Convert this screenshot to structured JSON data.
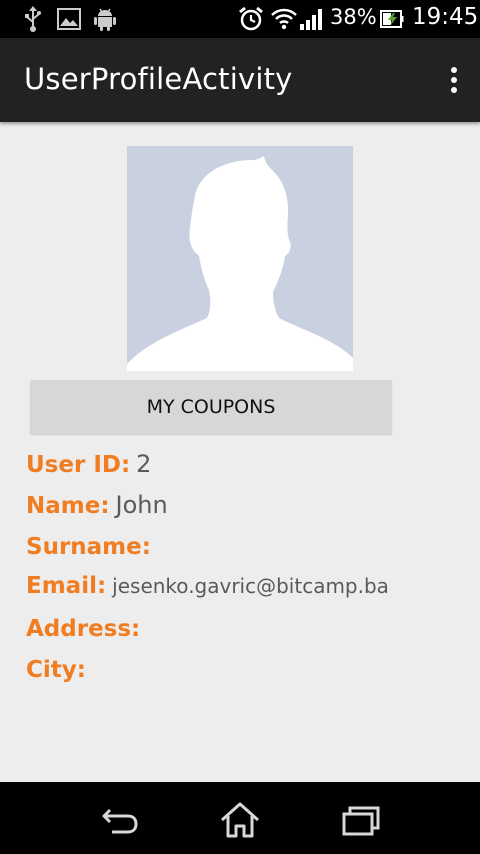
{
  "status_bar": {
    "battery_percent": "38%",
    "time": "19:45",
    "left_icons": [
      "usb-icon",
      "image-icon",
      "android-icon"
    ],
    "right_icons": [
      "alarm-icon",
      "wifi-icon",
      "signal-icon",
      "battery-charging-icon"
    ]
  },
  "action_bar": {
    "title": "UserProfileActivity",
    "overflow_icon": "more-vert-icon"
  },
  "profile": {
    "avatar_icon": "default-user-silhouette",
    "coupons_button": "MY COUPONS",
    "fields": {
      "user_id": {
        "label": "User ID:",
        "value": "2"
      },
      "name": {
        "label": "Name:",
        "value": "John"
      },
      "surname": {
        "label": "Surname:",
        "value": ""
      },
      "email": {
        "label": "Email:",
        "value": "jesenko.gavric@bitcamp.ba"
      },
      "address": {
        "label": "Address:",
        "value": ""
      },
      "city": {
        "label": "City:",
        "value": ""
      }
    }
  },
  "nav_bar": {
    "icons": [
      "back-icon",
      "home-icon",
      "recents-icon"
    ]
  },
  "colors": {
    "label_accent": "#f07d22",
    "action_bar": "#222222",
    "background": "#ededed",
    "avatar_bg": "#c9d1e1"
  }
}
